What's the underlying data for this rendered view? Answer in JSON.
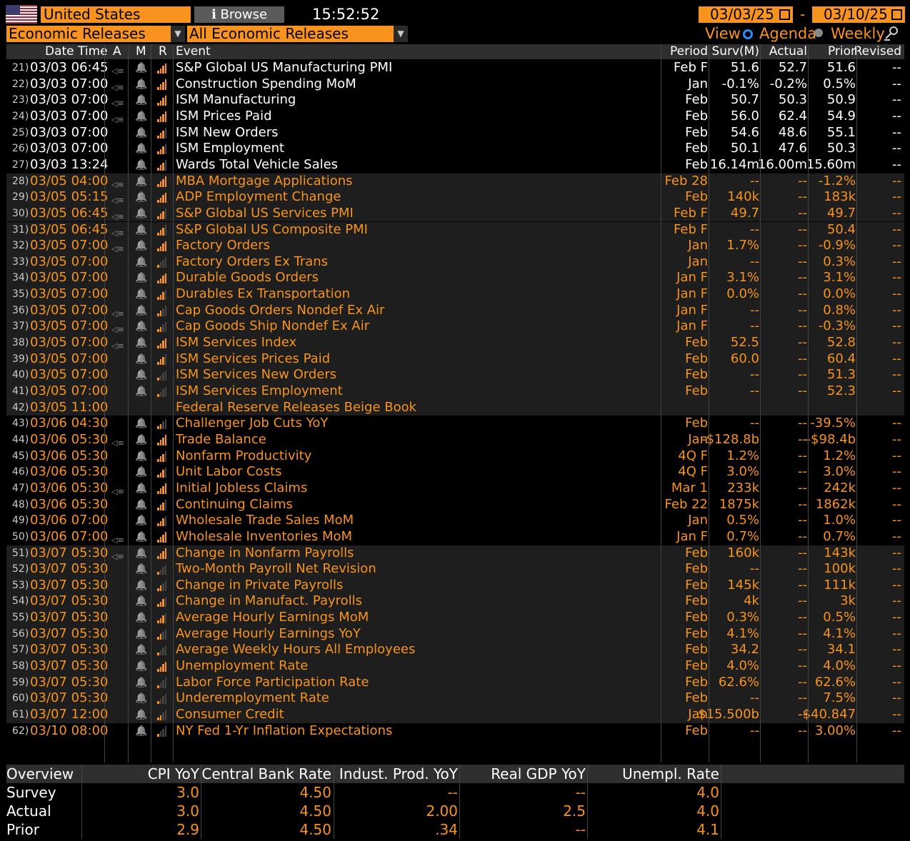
{
  "header": {
    "country": "United States",
    "browse_label": "ℹ Browse",
    "time": "15:52:52",
    "start_date": "03/03/25",
    "date_separator": "-",
    "end_date": "03/10/25",
    "filter_category": "Economic Releases",
    "filter_type": "All Economic Releases",
    "view_label": "View",
    "view_agenda": "Agenda",
    "view_weekly": "Weekly"
  },
  "columns": {
    "datetime": "Date Time",
    "a": "A",
    "m": "M",
    "r": "R",
    "event": "Event",
    "period": "Period",
    "survey": "Surv(M)",
    "actual": "Actual",
    "prior": "Prior",
    "revised": "Revised"
  },
  "rows": [
    {
      "n": "21)",
      "dt": "03/03 06:45",
      "alarm": true,
      "rel": 4,
      "ev": "S&P Global US Manufacturing PMI",
      "per": "Feb F",
      "surv": "51.6",
      "act": "52.7",
      "pri": "51.6",
      "rev": "--",
      "white": true,
      "shade": false
    },
    {
      "n": "22)",
      "dt": "03/03 07:00",
      "alarm": true,
      "rel": 4,
      "ev": "Construction Spending MoM",
      "per": "Jan",
      "surv": "-0.1%",
      "act": "-0.2%",
      "pri": "0.5%",
      "rev": "--",
      "white": true,
      "shade": false
    },
    {
      "n": "23)",
      "dt": "03/03 07:00",
      "alarm": true,
      "rel": 4,
      "ev": "ISM Manufacturing",
      "per": "Feb",
      "surv": "50.7",
      "act": "50.3",
      "pri": "50.9",
      "rev": "--",
      "white": true,
      "shade": false
    },
    {
      "n": "24)",
      "dt": "03/03 07:00",
      "alarm": true,
      "rel": 4,
      "ev": "ISM Prices Paid",
      "per": "Feb",
      "surv": "56.0",
      "act": "62.4",
      "pri": "54.9",
      "rev": "--",
      "white": true,
      "shade": false
    },
    {
      "n": "25)",
      "dt": "03/03 07:00",
      "alarm": false,
      "rel": 3,
      "ev": "ISM New Orders",
      "per": "Feb",
      "surv": "54.6",
      "act": "48.6",
      "pri": "55.1",
      "rev": "--",
      "white": true,
      "shade": false
    },
    {
      "n": "26)",
      "dt": "03/03 07:00",
      "alarm": false,
      "rel": 3,
      "ev": "ISM Employment",
      "per": "Feb",
      "surv": "50.1",
      "act": "47.6",
      "pri": "50.3",
      "rev": "--",
      "white": true,
      "shade": false
    },
    {
      "n": "27)",
      "dt": "03/03 13:24",
      "alarm": false,
      "rel": 3,
      "ev": "Wards Total Vehicle Sales",
      "per": "Feb",
      "surv": "16.14m",
      "act": "16.00m",
      "pri": "15.60m",
      "rev": "--",
      "white": true,
      "shade": false
    },
    {
      "n": "28)",
      "dt": "03/05 04:00",
      "alarm": true,
      "rel": 4,
      "ev": "MBA Mortgage Applications",
      "per": "Feb 28",
      "surv": "--",
      "act": "--",
      "pri": "-1.2%",
      "rev": "--",
      "white": false,
      "shade": true
    },
    {
      "n": "29)",
      "dt": "03/05 05:15",
      "alarm": true,
      "rel": 4,
      "ev": "ADP Employment Change",
      "per": "Feb",
      "surv": "140k",
      "act": "--",
      "pri": "183k",
      "rev": "--",
      "white": false,
      "shade": true
    },
    {
      "n": "30)",
      "dt": "03/05 06:45",
      "alarm": true,
      "rel": 3,
      "ev": "S&P Global US Services PMI",
      "per": "Feb F",
      "surv": "49.7",
      "act": "--",
      "pri": "49.7",
      "rev": "--",
      "white": false,
      "shade": true
    },
    {
      "n": "31)",
      "dt": "03/05 06:45",
      "alarm": true,
      "rel": 3,
      "ev": "S&P Global US Composite PMI",
      "per": "Feb F",
      "surv": "--",
      "act": "--",
      "pri": "50.4",
      "rev": "--",
      "white": false,
      "shade": true
    },
    {
      "n": "32)",
      "dt": "03/05 07:00",
      "alarm": true,
      "rel": 4,
      "ev": "Factory Orders",
      "per": "Jan",
      "surv": "1.7%",
      "act": "--",
      "pri": "-0.9%",
      "rev": "--",
      "white": false,
      "shade": true
    },
    {
      "n": "33)",
      "dt": "03/05 07:00",
      "alarm": false,
      "rel": 1,
      "ev": "Factory Orders Ex Trans",
      "per": "Jan",
      "surv": "--",
      "act": "--",
      "pri": "0.3%",
      "rev": "--",
      "white": false,
      "shade": true
    },
    {
      "n": "34)",
      "dt": "03/05 07:00",
      "alarm": false,
      "rel": 4,
      "ev": "Durable Goods Orders",
      "per": "Jan F",
      "surv": "3.1%",
      "act": "--",
      "pri": "3.1%",
      "rev": "--",
      "white": false,
      "shade": true
    },
    {
      "n": "35)",
      "dt": "03/05 07:00",
      "alarm": false,
      "rel": 3,
      "ev": "Durables Ex Transportation",
      "per": "Jan F",
      "surv": "0.0%",
      "act": "--",
      "pri": "0.0%",
      "rev": "--",
      "white": false,
      "shade": true
    },
    {
      "n": "36)",
      "dt": "03/05 07:00",
      "alarm": true,
      "rel": 2,
      "ev": "Cap Goods Orders Nondef Ex Air",
      "per": "Jan F",
      "surv": "--",
      "act": "--",
      "pri": "0.8%",
      "rev": "--",
      "white": false,
      "shade": true
    },
    {
      "n": "37)",
      "dt": "03/05 07:00",
      "alarm": true,
      "rel": 2,
      "ev": "Cap Goods Ship Nondef Ex Air",
      "per": "Jan F",
      "surv": "--",
      "act": "--",
      "pri": "-0.3%",
      "rev": "--",
      "white": false,
      "shade": true
    },
    {
      "n": "38)",
      "dt": "03/05 07:00",
      "alarm": true,
      "rel": 4,
      "ev": "ISM Services Index",
      "per": "Feb",
      "surv": "52.5",
      "act": "--",
      "pri": "52.8",
      "rev": "--",
      "white": false,
      "shade": true
    },
    {
      "n": "39)",
      "dt": "03/05 07:00",
      "alarm": false,
      "rel": 3,
      "ev": "ISM Services Prices Paid",
      "per": "Feb",
      "surv": "60.0",
      "act": "--",
      "pri": "60.4",
      "rev": "--",
      "white": false,
      "shade": true
    },
    {
      "n": "40)",
      "dt": "03/05 07:00",
      "alarm": false,
      "rel": 1,
      "ev": "ISM Services New Orders",
      "per": "Feb",
      "surv": "--",
      "act": "--",
      "pri": "51.3",
      "rev": "--",
      "white": false,
      "shade": true
    },
    {
      "n": "41)",
      "dt": "03/05 07:00",
      "alarm": false,
      "rel": 1,
      "ev": "ISM Services Employment",
      "per": "Feb",
      "surv": "--",
      "act": "--",
      "pri": "52.3",
      "rev": "--",
      "white": false,
      "shade": true
    },
    {
      "n": "42)",
      "dt": "03/05 11:00",
      "alarm": false,
      "rel": 0,
      "ev": "Federal Reserve Releases Beige Book",
      "per": "",
      "surv": "",
      "act": "",
      "pri": "",
      "rev": "",
      "white": false,
      "shade": true
    },
    {
      "n": "43)",
      "dt": "03/06 04:30",
      "alarm": false,
      "rel": 2,
      "ev": "Challenger Job Cuts YoY",
      "per": "Feb",
      "surv": "--",
      "act": "--",
      "pri": "-39.5%",
      "rev": "--",
      "white": false,
      "shade": false
    },
    {
      "n": "44)",
      "dt": "03/06 05:30",
      "alarm": true,
      "rel": 4,
      "ev": "Trade Balance",
      "per": "Jan",
      "surv": "-$128.8b",
      "act": "--",
      "pri": "-$98.4b",
      "rev": "--",
      "white": false,
      "shade": false
    },
    {
      "n": "45)",
      "dt": "03/06 05:30",
      "alarm": false,
      "rel": 3,
      "ev": "Nonfarm Productivity",
      "per": "4Q F",
      "surv": "1.2%",
      "act": "--",
      "pri": "1.2%",
      "rev": "--",
      "white": false,
      "shade": false
    },
    {
      "n": "46)",
      "dt": "03/06 05:30",
      "alarm": false,
      "rel": 3,
      "ev": "Unit Labor Costs",
      "per": "4Q F",
      "surv": "3.0%",
      "act": "--",
      "pri": "3.0%",
      "rev": "--",
      "white": false,
      "shade": false
    },
    {
      "n": "47)",
      "dt": "03/06 05:30",
      "alarm": true,
      "rel": 4,
      "ev": "Initial Jobless Claims",
      "per": "Mar 1",
      "surv": "233k",
      "act": "--",
      "pri": "242k",
      "rev": "--",
      "white": false,
      "shade": false
    },
    {
      "n": "48)",
      "dt": "03/06 05:30",
      "alarm": false,
      "rel": 3,
      "ev": "Continuing Claims",
      "per": "Feb 22",
      "surv": "1875k",
      "act": "--",
      "pri": "1862k",
      "rev": "--",
      "white": false,
      "shade": false
    },
    {
      "n": "49)",
      "dt": "03/06 07:00",
      "alarm": false,
      "rel": 3,
      "ev": "Wholesale Trade Sales MoM",
      "per": "Jan",
      "surv": "0.5%",
      "act": "--",
      "pri": "1.0%",
      "rev": "--",
      "white": false,
      "shade": false
    },
    {
      "n": "50)",
      "dt": "03/06 07:00",
      "alarm": true,
      "rel": 4,
      "ev": "Wholesale Inventories MoM",
      "per": "Jan F",
      "surv": "0.7%",
      "act": "--",
      "pri": "0.7%",
      "rev": "--",
      "white": false,
      "shade": false
    },
    {
      "n": "51)",
      "dt": "03/07 05:30",
      "alarm": true,
      "rel": 4,
      "ev": "Change in Nonfarm Payrolls",
      "per": "Feb",
      "surv": "160k",
      "act": "--",
      "pri": "143k",
      "rev": "--",
      "white": false,
      "shade": true
    },
    {
      "n": "52)",
      "dt": "03/07 05:30",
      "alarm": false,
      "rel": 1,
      "ev": "Two-Month Payroll Net Revision",
      "per": "Feb",
      "surv": "--",
      "act": "--",
      "pri": "100k",
      "rev": "--",
      "white": false,
      "shade": true
    },
    {
      "n": "53)",
      "dt": "03/07 05:30",
      "alarm": false,
      "rel": 2,
      "ev": "Change in Private Payrolls",
      "per": "Feb",
      "surv": "145k",
      "act": "--",
      "pri": "111k",
      "rev": "--",
      "white": false,
      "shade": true
    },
    {
      "n": "54)",
      "dt": "03/07 05:30",
      "alarm": false,
      "rel": 3,
      "ev": "Change in Manufact. Payrolls",
      "per": "Feb",
      "surv": "4k",
      "act": "--",
      "pri": "3k",
      "rev": "--",
      "white": false,
      "shade": true
    },
    {
      "n": "55)",
      "dt": "03/07 05:30",
      "alarm": false,
      "rel": 3,
      "ev": "Average Hourly Earnings MoM",
      "per": "Feb",
      "surv": "0.3%",
      "act": "--",
      "pri": "0.5%",
      "rev": "--",
      "white": false,
      "shade": true
    },
    {
      "n": "56)",
      "dt": "03/07 05:30",
      "alarm": false,
      "rel": 2,
      "ev": "Average Hourly Earnings YoY",
      "per": "Feb",
      "surv": "4.1%",
      "act": "--",
      "pri": "4.1%",
      "rev": "--",
      "white": false,
      "shade": true
    },
    {
      "n": "57)",
      "dt": "03/07 05:30",
      "alarm": false,
      "rel": 1,
      "ev": "Average Weekly Hours All Employees",
      "per": "Feb",
      "surv": "34.2",
      "act": "--",
      "pri": "34.1",
      "rev": "--",
      "white": false,
      "shade": true
    },
    {
      "n": "58)",
      "dt": "03/07 05:30",
      "alarm": false,
      "rel": 4,
      "ev": "Unemployment Rate",
      "per": "Feb",
      "surv": "4.0%",
      "act": "--",
      "pri": "4.0%",
      "rev": "--",
      "white": false,
      "shade": true
    },
    {
      "n": "59)",
      "dt": "03/07 05:30",
      "alarm": false,
      "rel": 1,
      "ev": "Labor Force Participation Rate",
      "per": "Feb",
      "surv": "62.6%",
      "act": "--",
      "pri": "62.6%",
      "rev": "--",
      "white": false,
      "shade": true
    },
    {
      "n": "60)",
      "dt": "03/07 05:30",
      "alarm": false,
      "rel": 1,
      "ev": "Underemployment Rate",
      "per": "Feb",
      "surv": "--",
      "act": "--",
      "pri": "7.5%",
      "rev": "--",
      "white": false,
      "shade": true
    },
    {
      "n": "61)",
      "dt": "03/07 12:00",
      "alarm": false,
      "rel": 2,
      "ev": "Consumer Credit",
      "per": "Jan",
      "surv": "$15.500b",
      "act": "--",
      "pri": "$40.847",
      "rev": "--",
      "white": false,
      "shade": true
    },
    {
      "n": "62)",
      "dt": "03/10 08:00",
      "alarm": false,
      "rel": 1,
      "ev": "NY Fed 1-Yr Inflation Expectations",
      "per": "Feb",
      "surv": "--",
      "act": "--",
      "pri": "3.00%",
      "rev": "--",
      "white": false,
      "shade": false
    }
  ],
  "overview": {
    "title": "Overview",
    "headers": [
      "CPI YoY",
      "Central Bank Rate",
      "Indust. Prod. YoY",
      "Real GDP YoY",
      "Unempl. Rate"
    ],
    "rows": [
      {
        "label": "Survey",
        "values": [
          "3.0",
          "4.50",
          "--",
          "--",
          "4.0"
        ]
      },
      {
        "label": "Actual",
        "values": [
          "3.0",
          "4.50",
          "2.00",
          "2.5",
          "4.0"
        ]
      },
      {
        "label": "Prior",
        "values": [
          "2.9",
          "4.50",
          ".34",
          "--",
          "4.1"
        ]
      }
    ]
  },
  "colors": {
    "accent": "#f7931e",
    "header_bg": "#2f2f2f",
    "shade_bg": "#1e1e1e",
    "bell": "#888888"
  }
}
